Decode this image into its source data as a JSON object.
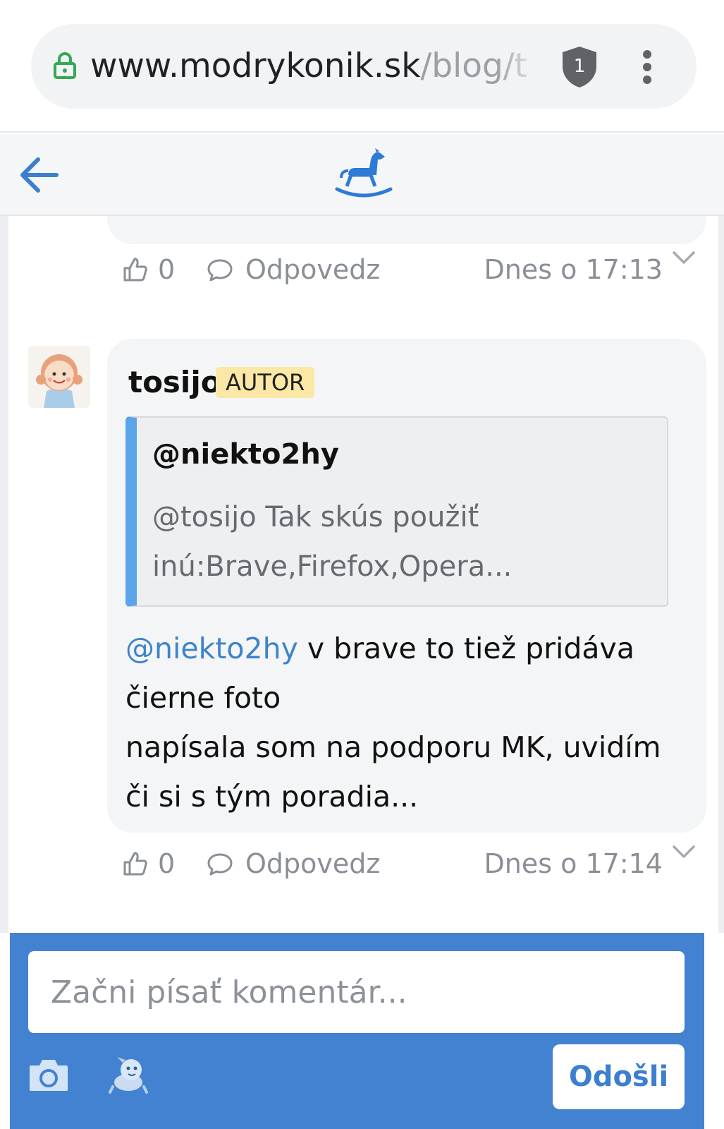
{
  "browser": {
    "url_domain": "www.modrykonik.sk",
    "url_path": "/blog/t",
    "shield_count": "1",
    "icons": [
      "lock-icon",
      "shield-icon",
      "menu-icon"
    ]
  },
  "header": {
    "icons": [
      "back-arrow-icon",
      "rocking-horse-logo-icon"
    ]
  },
  "comments": [
    {
      "likes": "0",
      "reply_label": "Odpovedz",
      "time": "Dnes o 17:13"
    },
    {
      "author": "tosijo",
      "badge": "AUTOR",
      "quote": {
        "author": "@niekto2hy",
        "text_line1": "@tosijo Tak skús použiť",
        "text_line2": "inú:Brave,Firefox,Opera..."
      },
      "body": {
        "mention": "@niekto2hy",
        "line1_rest": " v brave to tiež pridáva",
        "line2": "čierne foto",
        "line3": "napísala som na podporu MK, uvidím",
        "line4": "či si s tým poradia..."
      },
      "likes": "0",
      "reply_label": "Odpovedz",
      "time": "Dnes o 17:14"
    }
  ],
  "composer": {
    "placeholder": "Začni písať komentár...",
    "send_label": "Odošli",
    "icons": [
      "camera-icon",
      "sticker-icon"
    ]
  },
  "colors": {
    "accent_blue": "#4382d1",
    "mention_blue": "#3d84c9",
    "quote_bar": "#5aa4ea",
    "badge_bg": "#fbe8a6",
    "lock_green": "#34a853"
  }
}
